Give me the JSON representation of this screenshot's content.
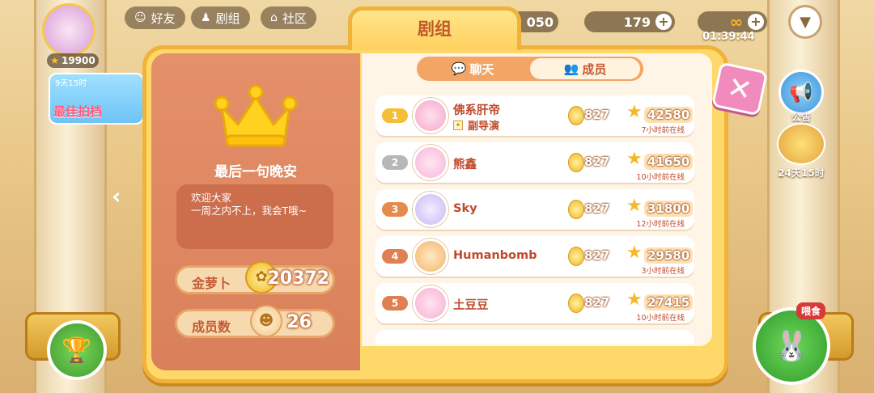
{
  "topbar": {
    "friends_label": "好友",
    "crew_label": "剧组",
    "community_label": "社区",
    "currency1": "050",
    "gems": "179",
    "energy": "∞",
    "timer": "01:39:44"
  },
  "left_hud": {
    "player_coins": "19900",
    "event_time": "9天15时",
    "event_name": "最佳拍档"
  },
  "right_hud": {
    "notice_label": "公告",
    "timer_label": "24天15时",
    "feed_label": "喂食"
  },
  "modal": {
    "title": "剧组",
    "team_name": "最后一句晚安",
    "description": [
      "欢迎大家",
      "一周之内不上，我会T哦~"
    ],
    "gold_label": "金萝卜",
    "gold_value": "20372",
    "members_label": "成员数",
    "members_value": "26",
    "tabs": {
      "chat": "聊天",
      "members": "成员"
    },
    "members": [
      {
        "rank": "1",
        "name": "佛系肝帝",
        "role": "副导演",
        "points": "827",
        "score": "42580",
        "online": "7小时前在线",
        "avatar_color": "#f6a6c8"
      },
      {
        "rank": "2",
        "name": "熊鑫",
        "role": "",
        "points": "827",
        "score": "41650",
        "online": "10小时前在线",
        "avatar_color": "#f7b6d8"
      },
      {
        "rank": "3",
        "name": "Sky",
        "role": "",
        "points": "827",
        "score": "31800",
        "online": "12小时前在线",
        "avatar_color": "#c9b8f4"
      },
      {
        "rank": "4",
        "name": "Humanbomb",
        "role": "",
        "points": "827",
        "score": "29580",
        "online": "3小时前在线",
        "avatar_color": "#f4b46a"
      },
      {
        "rank": "5",
        "name": "土豆豆",
        "role": "",
        "points": "827",
        "score": "27415",
        "online": "10小时前在线",
        "avatar_color": "#f7b0d0"
      }
    ]
  }
}
